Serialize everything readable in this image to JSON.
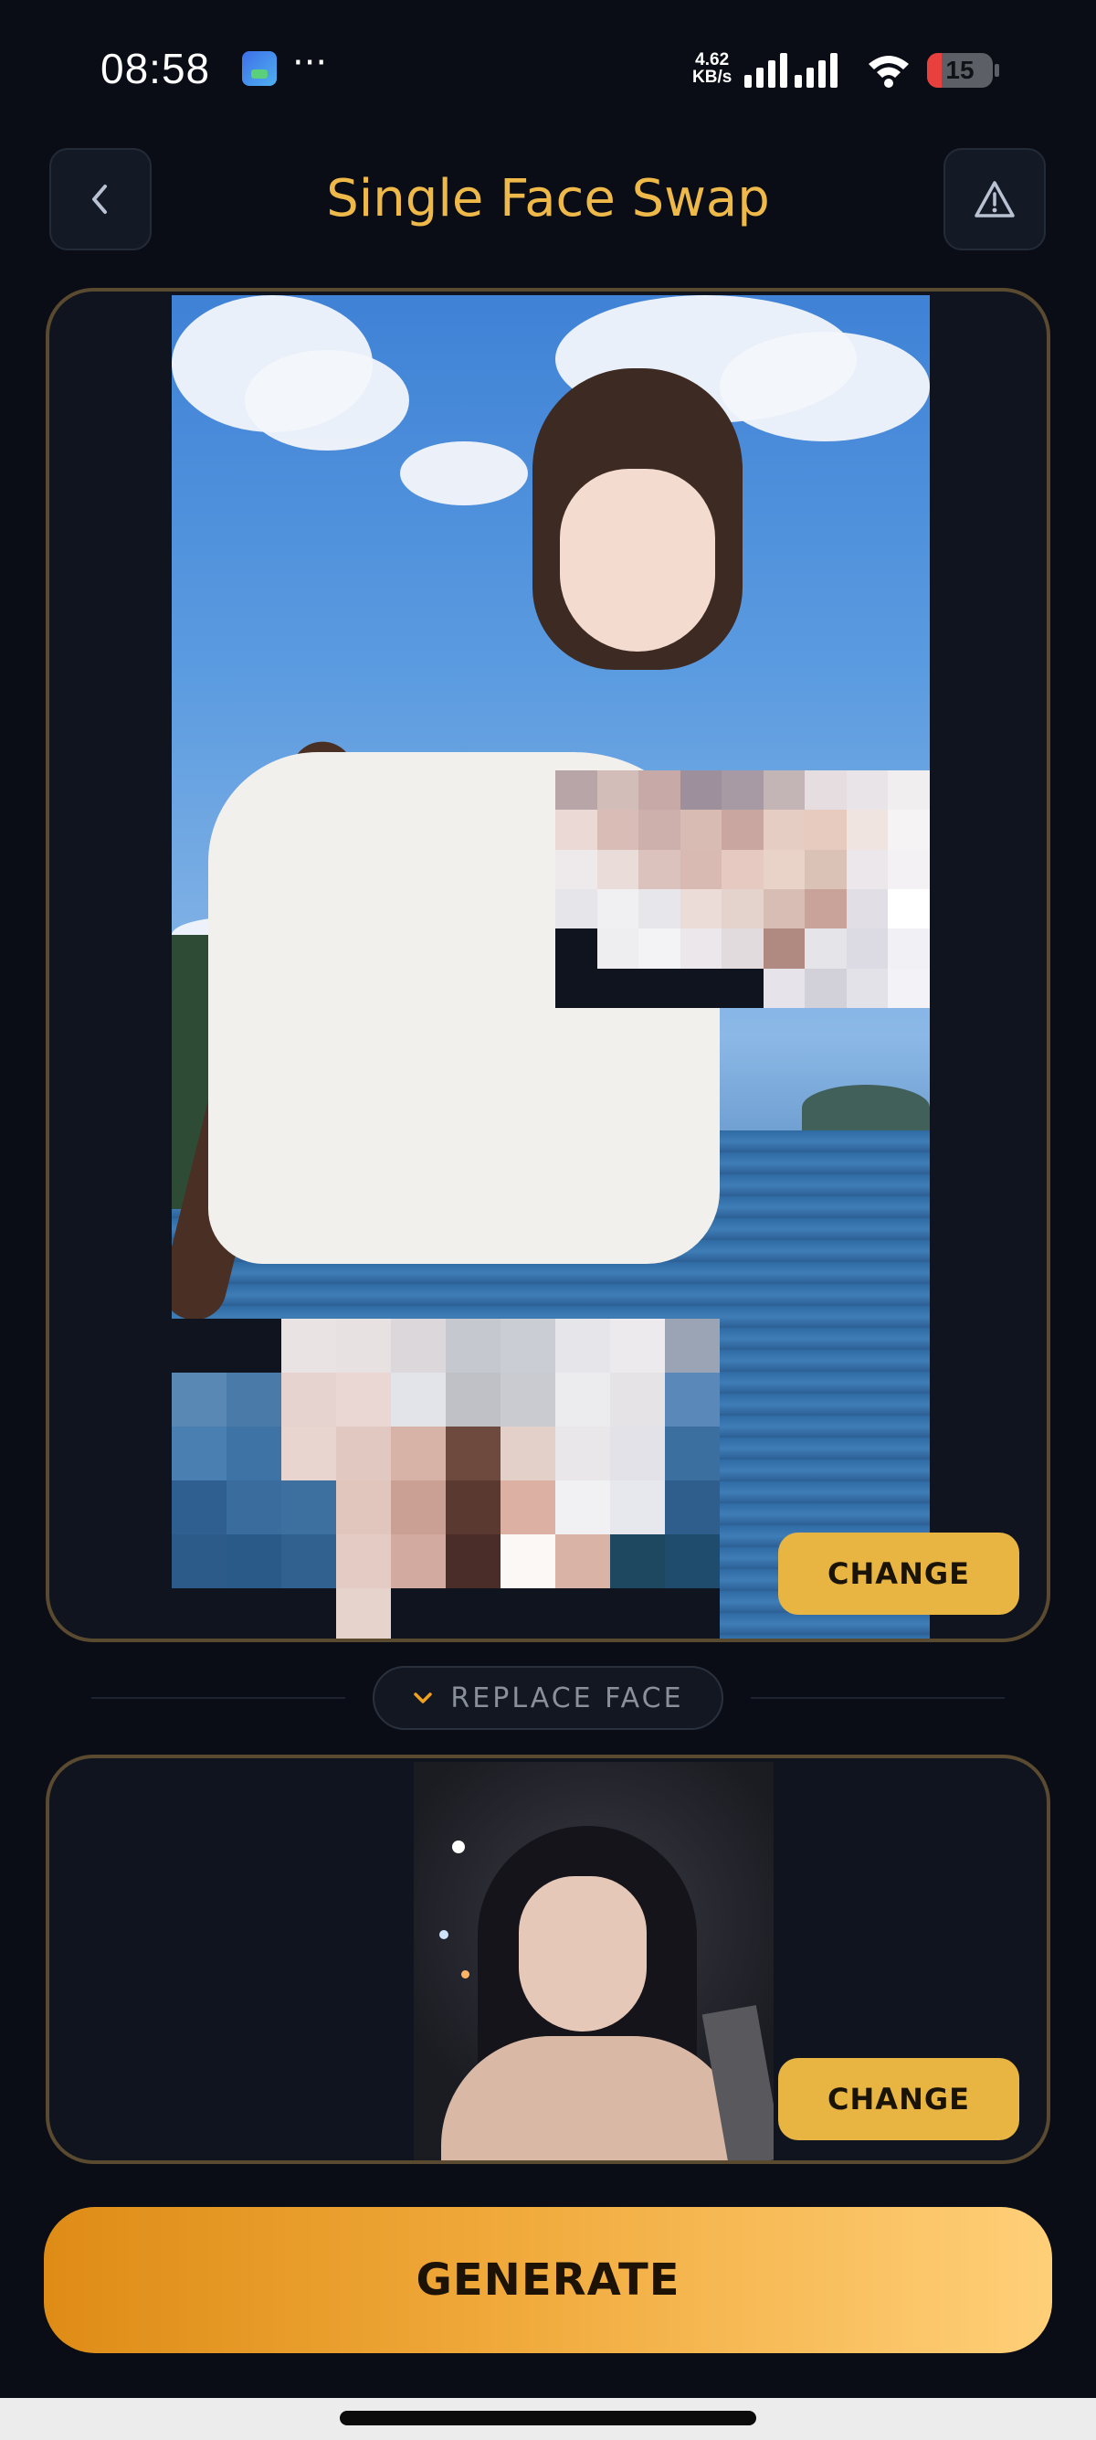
{
  "status_bar": {
    "time": "08:58",
    "more": "···",
    "net_speed_value": "4.62",
    "net_speed_unit": "KB/s",
    "battery_level": "15"
  },
  "header": {
    "back_icon": "chevron-left-icon",
    "title": "Single Face Swap",
    "report_icon": "warning-triangle-icon"
  },
  "target": {
    "change_label": "CHANGE"
  },
  "replace": {
    "label": "REPLACE FACE",
    "icon": "chevron-down-icon"
  },
  "source": {
    "change_label": "CHANGE"
  },
  "generate": {
    "label": "GENERATE"
  },
  "colors": {
    "accent": "#efb94a",
    "button": "#e8b543",
    "background": "#0a0d15",
    "card_border": "#5a4a2f"
  }
}
